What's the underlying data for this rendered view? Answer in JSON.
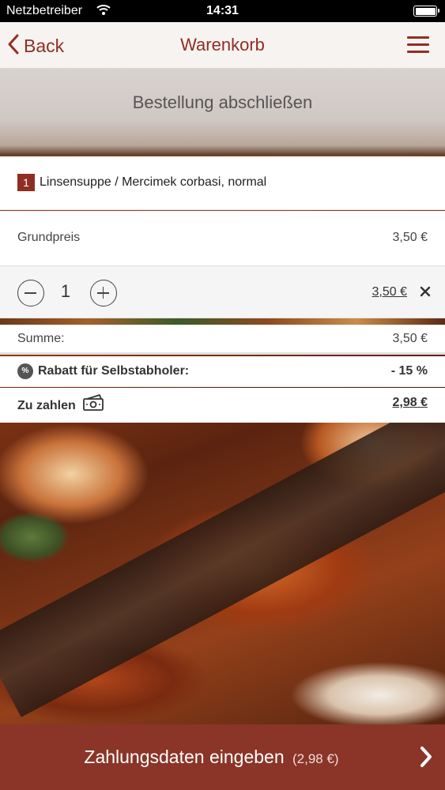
{
  "status_bar": {
    "carrier": "Netzbetreiber",
    "time": "14:31"
  },
  "nav": {
    "back_label": "Back",
    "title": "Warenkorb",
    "menu_icon": "hamburger-icon"
  },
  "header": {
    "title": "Bestellung abschließen"
  },
  "cart": {
    "items": [
      {
        "quantity_badge": "1",
        "name": "Linsensuppe / Mercimek corbasi, normal",
        "base_price_label": "Grundpreis",
        "base_price": "3,50 €",
        "quantity": "1",
        "line_total": "3,50 €"
      }
    ]
  },
  "summary": {
    "sum_label": "Summe:",
    "sum_value": "3,50 €",
    "discount_label": "Rabatt für Selbstabholer:",
    "discount_value": "- 15 %",
    "discount_icon_text": "%",
    "to_pay_label": "Zu zahlen",
    "to_pay_value": "2,98 €"
  },
  "cta": {
    "label": "Zahlungsdaten eingeben",
    "amount": "(2,98 €)"
  },
  "colors": {
    "accent": "#8f2f22",
    "cta_background": "#8a3528"
  }
}
